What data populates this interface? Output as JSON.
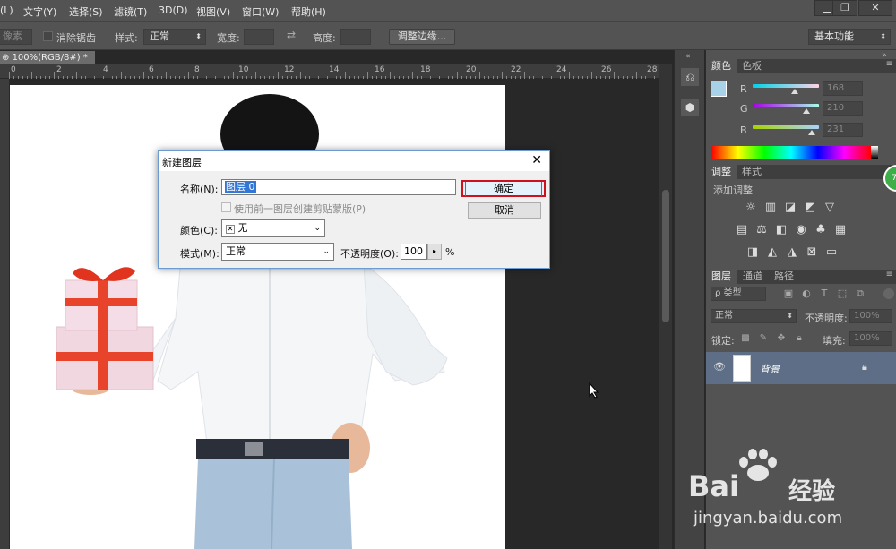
{
  "menubar": {
    "items": [
      "(L)",
      "文字(Y)",
      "选择(S)",
      "滤镜(T)",
      "3D(D)",
      "视图(V)",
      "窗口(W)",
      "帮助(H)"
    ],
    "window_buttons": [
      "▁",
      "❐",
      "✕"
    ]
  },
  "options": {
    "feather_label": "像素",
    "antialias_label": "消除锯齿",
    "style_label": "样式:",
    "style_value": "正常",
    "width_label": "宽度:",
    "height_label": "高度:",
    "refine_edge_button": "调整边缘...",
    "workspace_value": "基本功能"
  },
  "document": {
    "tab_label": "100%(RGB/8#) *",
    "tab_close": "×",
    "ruler_labels": [
      "0",
      "2",
      "4",
      "6",
      "8",
      "10",
      "12",
      "14",
      "16",
      "18",
      "20",
      "22",
      "24",
      "26",
      "28"
    ]
  },
  "color_panel": {
    "tabs": [
      "颜色",
      "色板"
    ],
    "channels": [
      {
        "name": "R",
        "value": "168"
      },
      {
        "name": "G",
        "value": "210"
      },
      {
        "name": "B",
        "value": "231"
      }
    ],
    "foreground_color": "#a8d2e7",
    "background_color": "#ffffff"
  },
  "adjust_panel": {
    "tabs": [
      "调整",
      "样式"
    ],
    "add_label": "添加调整"
  },
  "layers_panel": {
    "tabs": [
      "图层",
      "通道",
      "路径"
    ],
    "filter_label": "ρ 类型",
    "blend_mode": "正常",
    "opacity_label": "不透明度:",
    "opacity_value": "100%",
    "lock_label": "锁定:",
    "fill_label": "填充:",
    "fill_value": "100%",
    "layer_name": "背景"
  },
  "dialog": {
    "title": "新建图层",
    "close": "✕",
    "name_label": "名称(N):",
    "name_value": "图层 0",
    "use_previous_label": "使用前一图层创建剪贴蒙版(P)",
    "color_label": "颜色(C):",
    "color_value": "无",
    "mode_label": "模式(M):",
    "mode_value": "正常",
    "opacity_label": "不透明度(O):",
    "opacity_value": "100",
    "opacity_unit": "%",
    "ok_button": "确定",
    "cancel_button": "取消"
  },
  "watermark": {
    "brand": "Bai",
    "brand_suffix": "经验",
    "url": "jingyan.baidu.com"
  }
}
